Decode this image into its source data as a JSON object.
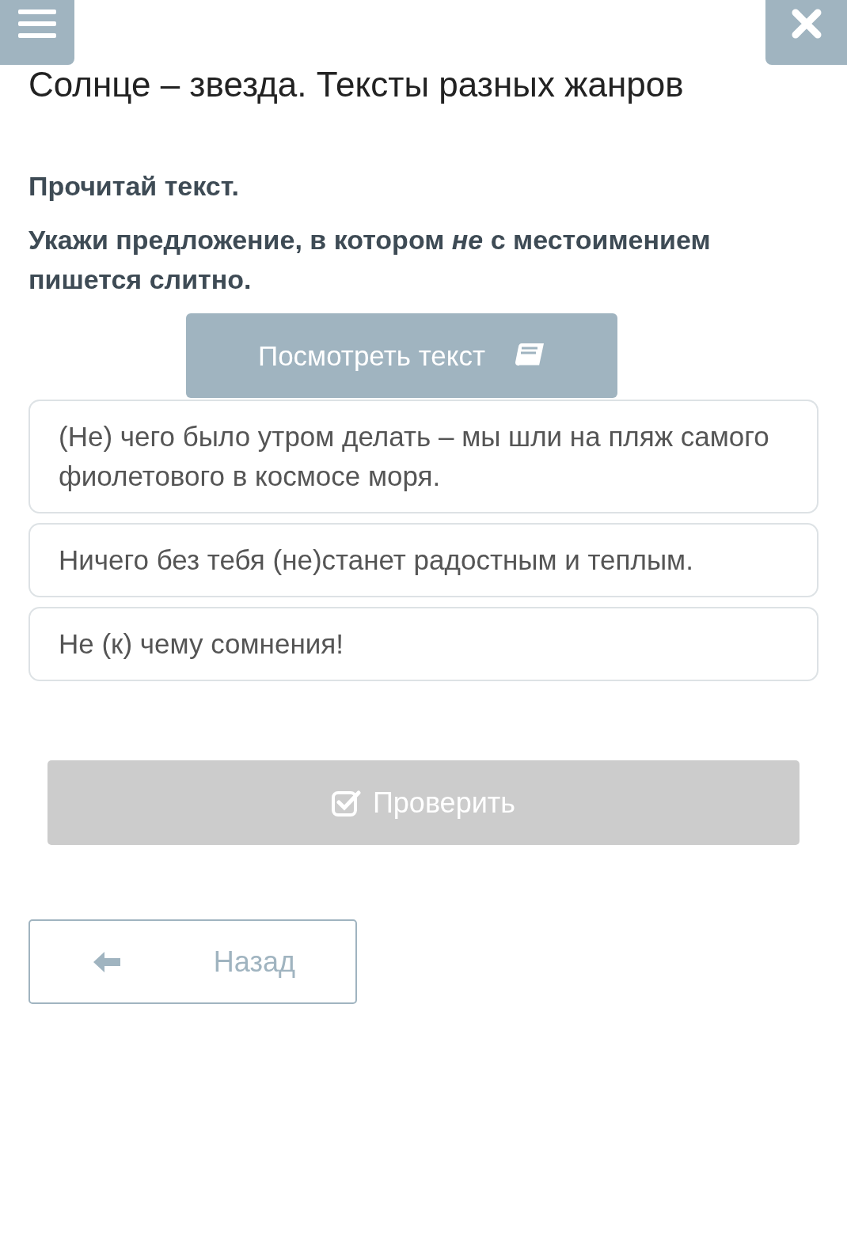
{
  "title": "Солнце – звезда. Тексты разных жанров",
  "instructions": [
    "Прочитай текст.",
    "Укажи предложение, в котором *не* с местоимением пишется слитно."
  ],
  "view_text_button": {
    "label": "Посмотреть текст"
  },
  "options": [
    {
      "text": "(Не) чего было утром делать – мы шли на пляж самого фиолетового в космосе моря.",
      "selected": false
    },
    {
      "text": "Ничего без тебя (не)станет радостным и теплым.",
      "selected": false
    },
    {
      "text": "Не (к) чему сомнения!",
      "selected": false
    }
  ],
  "check_button": {
    "label": "Проверить",
    "disabled": true
  },
  "back_button": {
    "label": "Назад"
  }
}
